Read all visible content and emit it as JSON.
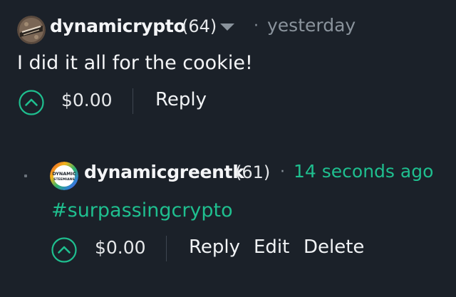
{
  "colors": {
    "background": "#1b2129",
    "accent": "#1fbf8f",
    "muted": "#8a939c",
    "text": "#f1f3f5"
  },
  "parent_comment": {
    "avatar_icon": "dynamiccrypto-avatar-icon",
    "author": "dynamicrypto",
    "reputation": "(64)",
    "menu_icon": "caret-down-icon",
    "separator": "·",
    "timestamp": "yesterday",
    "body": "I did it all for the cookie!",
    "upvote_icon": "chevron-up-circle-icon",
    "payout": "$0.00",
    "reply_label": "Reply"
  },
  "reply_comment": {
    "avatar_icon": "dynamicgreentk-avatar-icon",
    "avatar_text_top": "DYNAMIC",
    "avatar_text_bottom": "STEEMIANS",
    "author": "dynamicgreentk",
    "reputation": "(61)",
    "separator": "·",
    "timestamp": "14 seconds ago",
    "body": "#surpassingcrypto",
    "upvote_icon": "chevron-up-circle-icon",
    "payout": "$0.00",
    "reply_label": "Reply",
    "edit_label": "Edit",
    "delete_label": "Delete"
  }
}
